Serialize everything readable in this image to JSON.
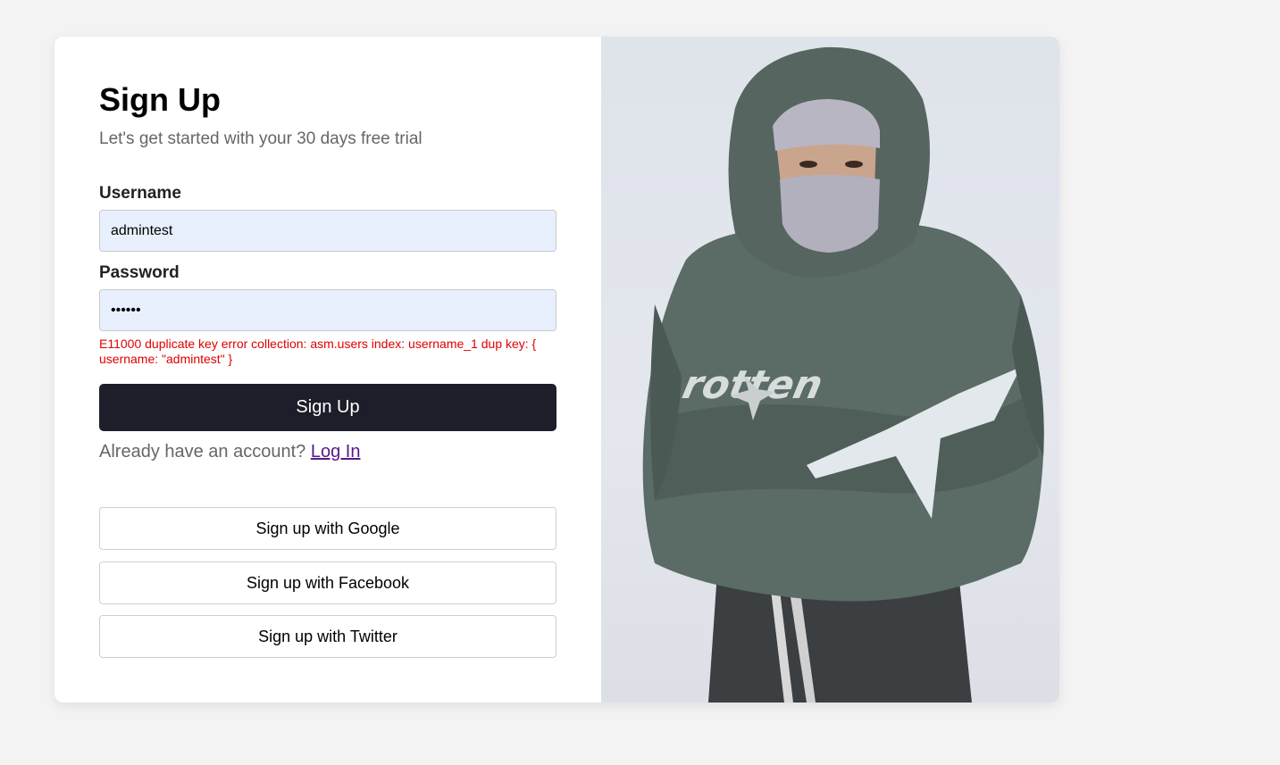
{
  "form": {
    "title": "Sign Up",
    "subtitle": "Let's get started with your 30 days free trial",
    "username_label": "Username",
    "username_value": "admintest",
    "password_label": "Password",
    "password_value": "••••••",
    "error_message": "E11000 duplicate key error collection: asm.users index: username_1 dup key: { username: \"admintest\" }",
    "submit_label": "Sign Up",
    "login_prompt": "Already have an account?",
    "login_link": "Log In"
  },
  "social": {
    "google_label": "Sign up with Google",
    "facebook_label": "Sign up with Facebook",
    "twitter_label": "Sign up with Twitter"
  },
  "hero_image": {
    "description_icon": "hooded-person-photo",
    "hoodie_color": "#5b6b66",
    "background_color": "#e1e5ec"
  },
  "colors": {
    "primary_button": "#1c1f29",
    "input_background": "#e8f0fe",
    "error_text": "#e00000",
    "link": "#551a8b"
  }
}
